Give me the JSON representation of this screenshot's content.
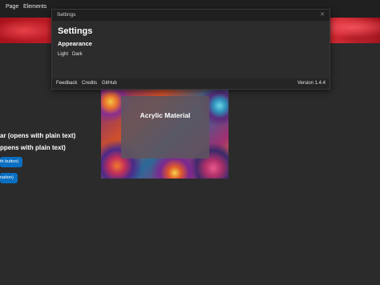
{
  "menu": {
    "items": [
      "Page",
      "Elements"
    ]
  },
  "background": {
    "lines": [
      "ar (opens with plain text)",
      "ppens with plain text)"
    ],
    "buttons": [
      "th button)",
      "nation)"
    ]
  },
  "acrylic": {
    "title": "Acrylic Material"
  },
  "settings": {
    "window_title": "Settings",
    "close_glyph": "✕",
    "heading": "Settings",
    "section": "Appearance",
    "theme_options": [
      "Light",
      "Dark"
    ],
    "footer_links": [
      "Feedback",
      "Credits",
      "GitHub"
    ],
    "version": "Version 1.4.4"
  },
  "colors": {
    "accent": "#0a6fc2",
    "banner": "#c9212b"
  }
}
